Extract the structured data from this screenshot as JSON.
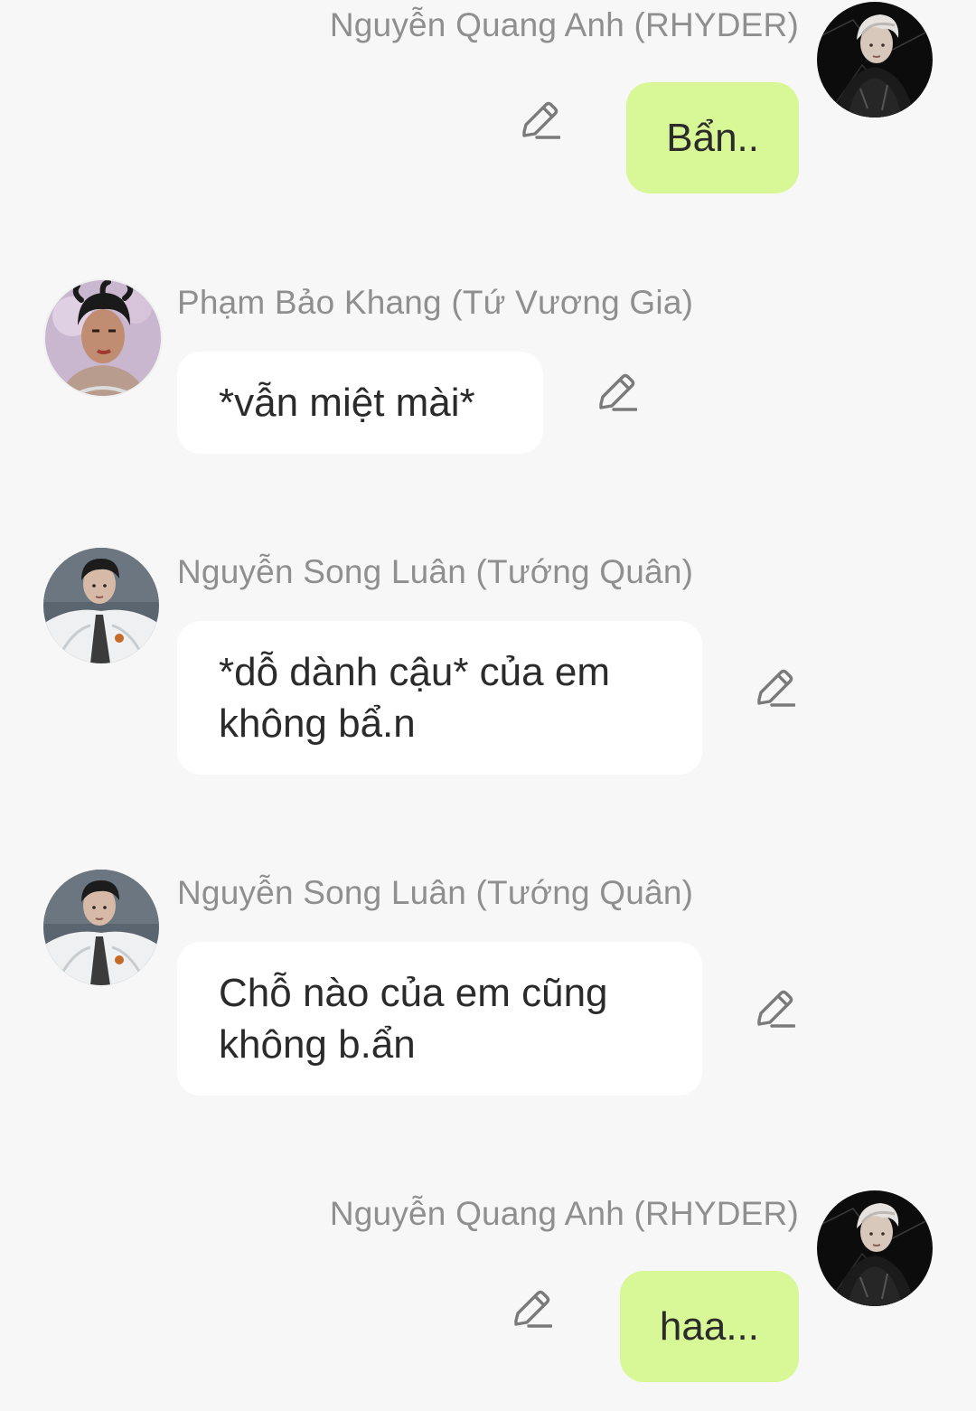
{
  "messages": [
    {
      "sender": "Nguyễn Quang Anh (RHYDER)",
      "side": "out",
      "text": "Bẩn..",
      "avatar_icon": "avatar-rhyder"
    },
    {
      "sender": "Phạm Bảo Khang (Tứ Vương Gia)",
      "side": "in",
      "text": "*vẫn miệt mài*",
      "avatar_icon": "avatar-khang"
    },
    {
      "sender": "Nguyễn Song Luân (Tướng Quân)",
      "side": "in",
      "text": "*dỗ dành cậu* của em không bẩ.n",
      "avatar_icon": "avatar-luan"
    },
    {
      "sender": "Nguyễn Song Luân (Tướng Quân)",
      "side": "in",
      "text": "Chỗ nào của em cũng không b.ẩn",
      "avatar_icon": "avatar-luan"
    },
    {
      "sender": "Nguyễn Quang Anh (RHYDER)",
      "side": "out",
      "text": "haa...",
      "avatar_icon": "avatar-rhyder"
    }
  ],
  "icons": {
    "edit": "pencil-edit-icon"
  },
  "colors": {
    "background": "#f7f7f7",
    "incoming_bubble": "#ffffff",
    "outgoing_bubble": "#d8f796",
    "sender_name": "#8f8f8f",
    "message_text": "#2b2b2b",
    "edit_icon": "#7a7a7a"
  }
}
